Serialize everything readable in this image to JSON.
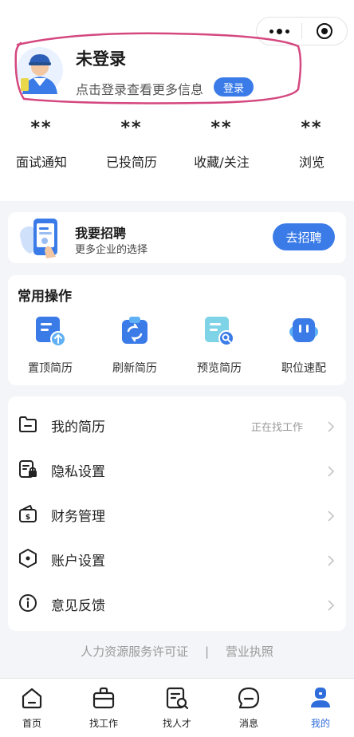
{
  "header": {
    "title": "未登录",
    "subtitle": "点击登录查看更多信息",
    "login_label": "登录"
  },
  "stats": [
    {
      "value": "**",
      "label": "面试通知"
    },
    {
      "value": "**",
      "label": "已投简历"
    },
    {
      "value": "**",
      "label": "收藏/关注"
    },
    {
      "value": "**",
      "label": "浏览"
    }
  ],
  "recruit": {
    "title": "我要招聘",
    "subtitle": "更多企业的选择",
    "button": "去招聘"
  },
  "ops": {
    "title": "常用操作",
    "items": [
      {
        "label": "置顶简历",
        "icon": "resume-top-icon"
      },
      {
        "label": "刷新简历",
        "icon": "refresh-resume-icon"
      },
      {
        "label": "预览简历",
        "icon": "preview-resume-icon"
      },
      {
        "label": "职位速配",
        "icon": "job-match-icon"
      }
    ]
  },
  "menu": [
    {
      "label": "我的简历",
      "right": "正在找工作",
      "icon": "folder-icon"
    },
    {
      "label": "隐私设置",
      "right": "",
      "icon": "privacy-lock-icon"
    },
    {
      "label": "财务管理",
      "right": "",
      "icon": "wallet-icon"
    },
    {
      "label": "账户设置",
      "right": "",
      "icon": "hexagon-settings-icon"
    },
    {
      "label": "意见反馈",
      "right": "",
      "icon": "info-icon"
    }
  ],
  "footer": {
    "license": "人力资源服务许可证",
    "divider": "|",
    "business": "营业执照"
  },
  "tabs": [
    {
      "label": "首页",
      "icon": "home-icon"
    },
    {
      "label": "找工作",
      "icon": "briefcase-icon"
    },
    {
      "label": "找人才",
      "icon": "talent-search-icon"
    },
    {
      "label": "消息",
      "icon": "message-icon"
    },
    {
      "label": "我的",
      "icon": "profile-icon"
    }
  ],
  "colors": {
    "accent": "#3a7be8",
    "highlight_stroke": "#d4487f",
    "background": "#f4f5f8"
  }
}
